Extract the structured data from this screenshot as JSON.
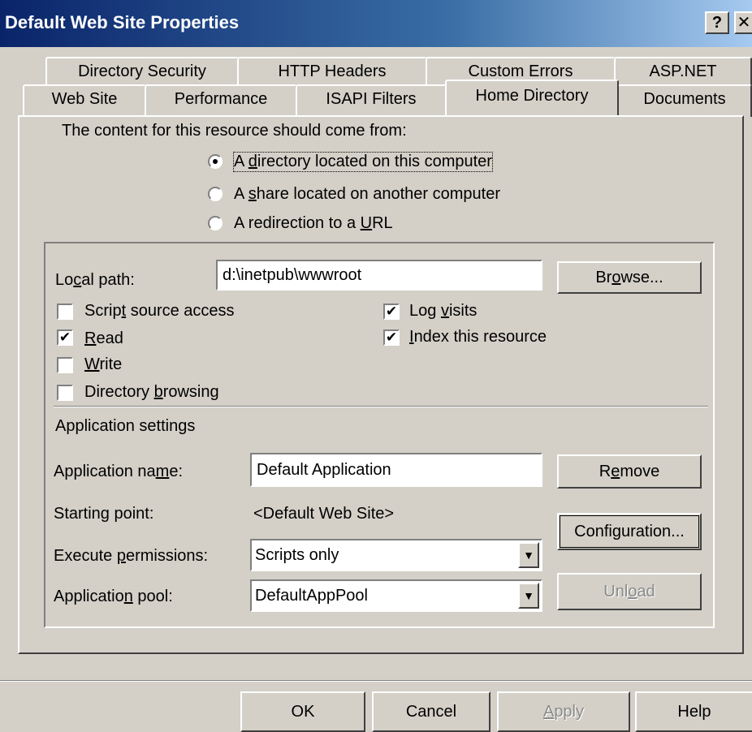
{
  "window": {
    "title": "Default Web Site Properties",
    "help_glyph": "?",
    "close_glyph": "✕"
  },
  "tabs_row1": [
    "Directory Security",
    "HTTP Headers",
    "Custom Errors",
    "ASP.NET"
  ],
  "tabs_row2": [
    "Web Site",
    "Performance",
    "ISAPI Filters",
    "Home Directory",
    "Documents"
  ],
  "content_source": {
    "prompt": "The content for this resource should come from:",
    "options": [
      {
        "pre": "A ",
        "u": "d",
        "post": "irectory located on this computer",
        "selected": true
      },
      {
        "pre": "A ",
        "u": "s",
        "post": "hare located on another computer",
        "selected": false
      },
      {
        "pre": "A redirection to a ",
        "u": "U",
        "post": "RL",
        "selected": false
      }
    ]
  },
  "local_path": {
    "label_pre": "Lo",
    "label_u": "c",
    "label_post": "al path:",
    "value": "d:\\inetpub\\wwwroot",
    "browse_pre": "Br",
    "browse_u": "o",
    "browse_post": "wse..."
  },
  "checkboxes": {
    "script_source": {
      "pre": "Scrip",
      "u": "t",
      "post": " source access",
      "checked": false
    },
    "read": {
      "pre": "",
      "u": "R",
      "post": "ead",
      "checked": true
    },
    "write": {
      "pre": "",
      "u": "W",
      "post": "rite",
      "checked": false
    },
    "dir_browsing": {
      "pre": "Directory ",
      "u": "b",
      "post": "rowsing",
      "checked": false
    },
    "log_visits": {
      "pre": "Log ",
      "u": "v",
      "post": "isits",
      "checked": true
    },
    "index": {
      "pre": "",
      "u": "I",
      "post": "ndex this resource",
      "checked": true
    }
  },
  "app_settings": {
    "heading": "Application settings",
    "name_label_pre": "Application na",
    "name_label_u": "m",
    "name_label_post": "e:",
    "name_value": "Default Application",
    "remove_pre": "R",
    "remove_u": "e",
    "remove_post": "move",
    "starting_label": "Starting point:",
    "starting_value": "<Default Web Site>",
    "config_pre": "Confi",
    "config_u": "g",
    "config_post": "uration...",
    "exec_label_pre": "Execute ",
    "exec_label_u": "p",
    "exec_label_post": "ermissions:",
    "exec_value": "Scripts only",
    "pool_label_pre": "Applicatio",
    "pool_label_u": "n",
    "pool_label_post": " pool:",
    "pool_value": "DefaultAppPool",
    "unload_pre": "Unl",
    "unload_u": "o",
    "unload_post": "ad"
  },
  "footer": {
    "ok": "OK",
    "cancel": "Cancel",
    "apply_u": "A",
    "apply_post": "pply",
    "help": "Help"
  },
  "glyphs": {
    "check": "✔",
    "dropdown_arrow": "▼"
  }
}
